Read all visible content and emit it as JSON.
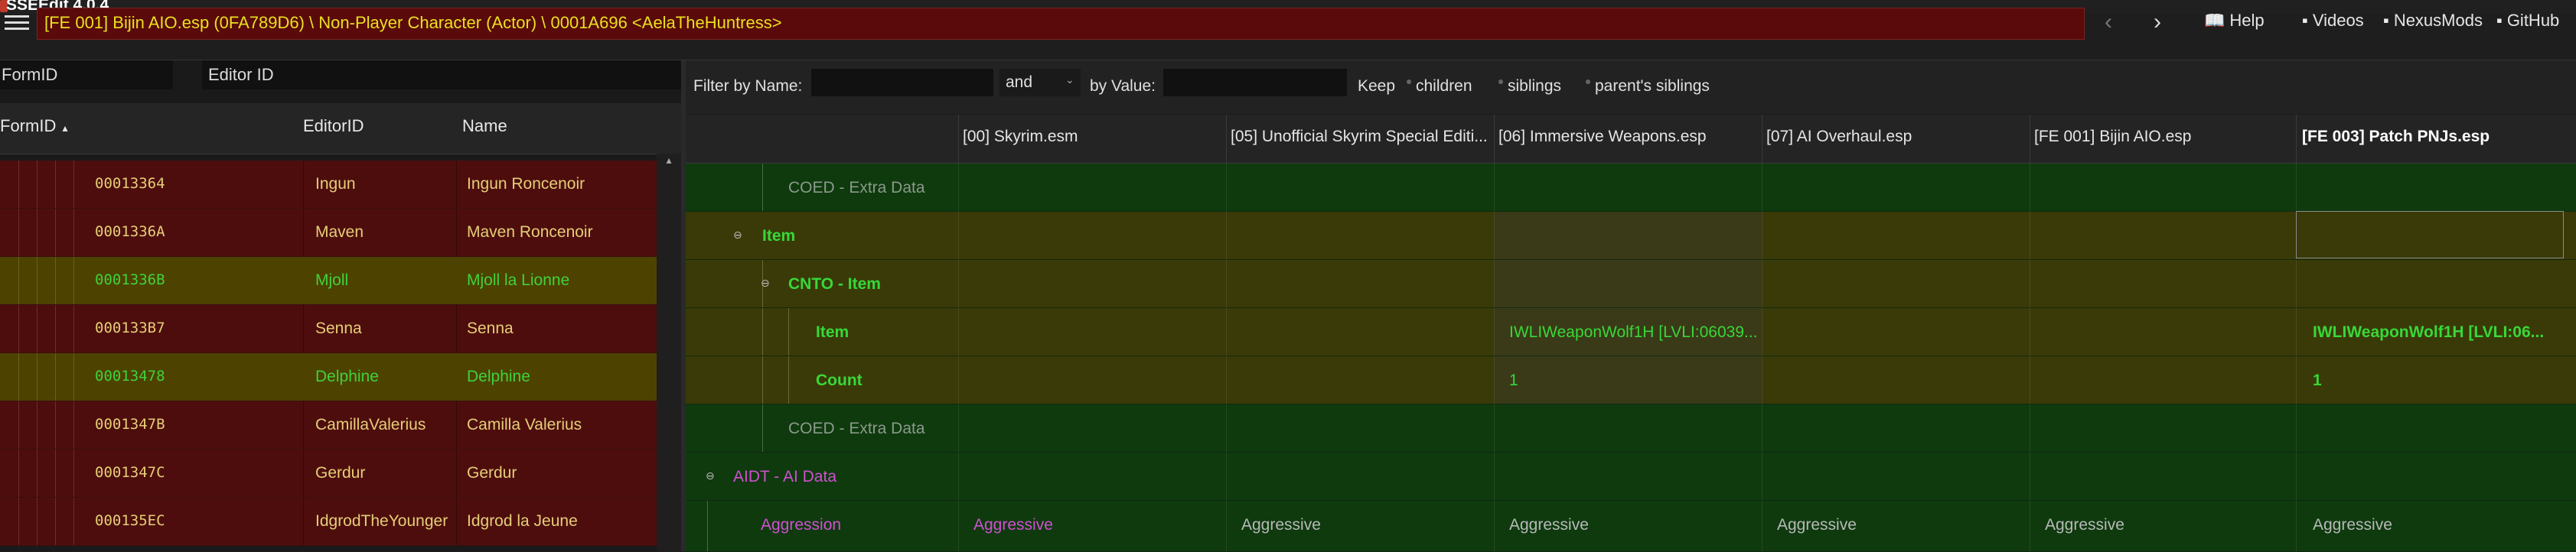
{
  "window": {
    "title": "SSEEdit 4.0.4"
  },
  "pathbar": {
    "path": "[FE 001] Bijin AIO.esp (0FA789D6) \\ Non-Player Character (Actor) \\ 0001A696 <AelaTheHuntress>",
    "links": [
      {
        "label": "Help",
        "icon": "book-icon"
      },
      {
        "label": "Videos",
        "icon": "video-icon"
      },
      {
        "label": "NexusMods",
        "icon": "nexus-icon"
      },
      {
        "label": "GitHub",
        "icon": "github-icon"
      }
    ]
  },
  "left": {
    "formid_placeholder": "FormID",
    "editorid_placeholder": "Editor ID",
    "columns": {
      "formid": "FormID",
      "formid_sort": "▴",
      "editorid": "EditorID",
      "name": "Name"
    },
    "rows": [
      {
        "formid": "00013364",
        "editorid": "Ingun",
        "name": "Ingun Roncenoir",
        "state": "red"
      },
      {
        "formid": "0001336A",
        "editorid": "Maven",
        "name": "Maven Roncenoir",
        "state": "red"
      },
      {
        "formid": "0001336B",
        "editorid": "Mjoll",
        "name": "Mjoll la Lionne",
        "state": "yellow"
      },
      {
        "formid": "000133B7",
        "editorid": "Senna",
        "name": "Senna",
        "state": "red"
      },
      {
        "formid": "00013478",
        "editorid": "Delphine",
        "name": "Delphine",
        "state": "yellow"
      },
      {
        "formid": "0001347B",
        "editorid": "CamillaValerius",
        "name": "Camilla Valerius",
        "state": "red"
      },
      {
        "formid": "0001347C",
        "editorid": "Gerdur",
        "name": "Gerdur",
        "state": "red"
      },
      {
        "formid": "000135EC",
        "editorid": "IdgrodTheYounger",
        "name": "Idgrod la Jeune",
        "state": "red"
      }
    ]
  },
  "filter": {
    "by_name": "Filter by Name:",
    "and": "and",
    "by_value": "by Value:",
    "keep": "Keep",
    "children": "children",
    "siblings": "siblings",
    "parents_siblings": "parent's siblings"
  },
  "right": {
    "columns": [
      "[00] Skyrim.esm",
      "[05] Unofficial Skyrim Special Editi...",
      "[06] Immersive Weapons.esp",
      "[07] AI Overhaul.esp",
      "[FE 001] Bijin AIO.esp",
      "[FE 003] Patch PNJs.esp"
    ],
    "rows": {
      "coed1": "COED - Extra Data",
      "item": "Item",
      "cnto": "CNTO - Item",
      "item_sub": "Item",
      "item_val_iw": "IWLIWeaponWolf1H [LVLI:06039...",
      "item_val_patch": "IWLIWeaponWolf1H [LVLI:06...",
      "count": "Count",
      "count_val_iw": "1",
      "count_val_patch": "1",
      "coed2": "COED - Extra Data",
      "aidt": "AIDT - AI Data",
      "aggression": "Aggression",
      "aggr_values": [
        "Aggressive",
        "Aggressive",
        "Aggressive",
        "Aggressive",
        "Aggressive",
        "Aggressive"
      ]
    }
  }
}
